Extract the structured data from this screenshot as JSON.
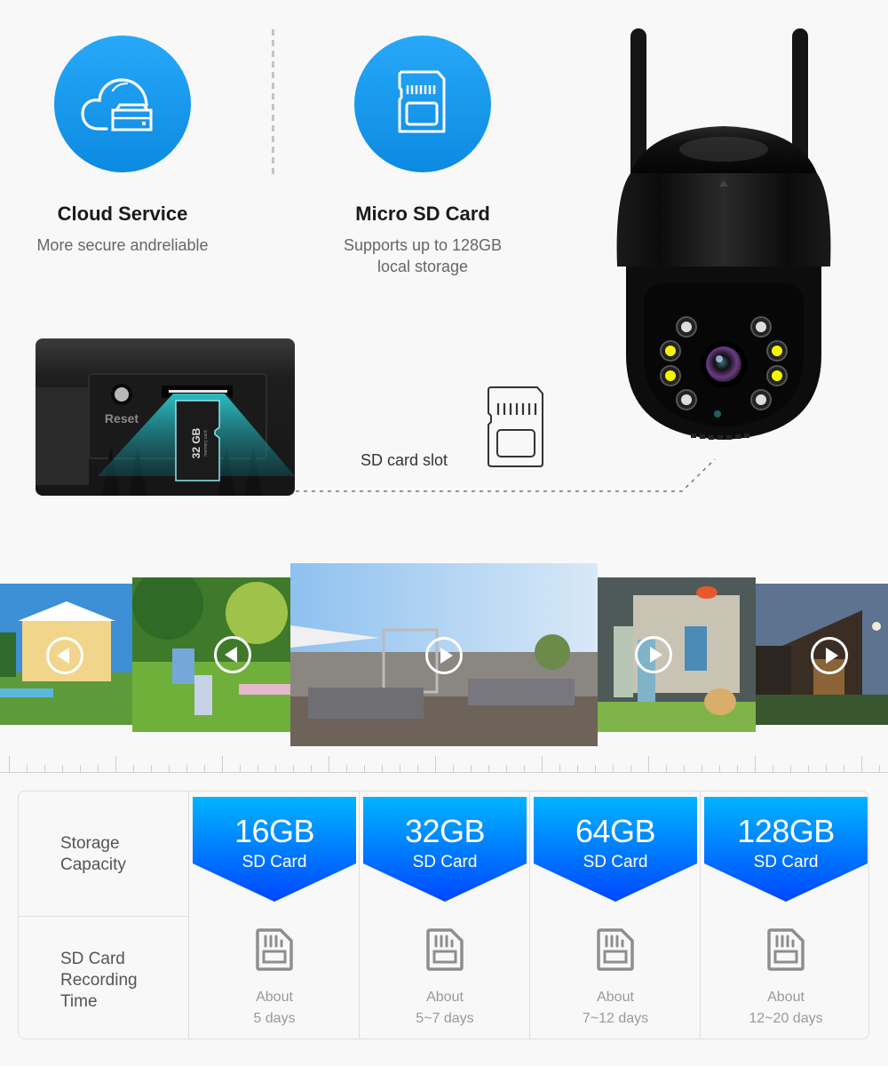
{
  "features": [
    {
      "icon": "cloud-storage-icon",
      "title": "Cloud Service",
      "subtitle": [
        "More secure andreliable"
      ]
    },
    {
      "icon": "micro-sd-card-icon",
      "title": "Micro SD Card",
      "subtitle": [
        "Supports up to 128GB",
        "local storage"
      ]
    }
  ],
  "slot_photo": {
    "reset_label": "Reset",
    "card_label": "32 GB",
    "card_sublabel": "memory card"
  },
  "slot_callout": {
    "label": "SD card slot",
    "icon": "sd-card-outline-icon"
  },
  "camera": {
    "name": "PTZ security camera"
  },
  "photos": [
    {
      "scene": "yellow villa with pool",
      "icon": "play-icon"
    },
    {
      "scene": "family picnic on lawn",
      "icon": "play-icon"
    },
    {
      "scene": "rooftop terrace lounge",
      "icon": "play-icon"
    },
    {
      "scene": "family playing frisbee with dog",
      "icon": "play-icon"
    },
    {
      "scene": "modern house at dusk",
      "icon": "play-icon"
    }
  ],
  "table": {
    "row_headers": [
      [
        "Storage",
        "Capacity"
      ],
      [
        "SD Card",
        "Recording",
        "Time"
      ]
    ],
    "columns": [
      {
        "capacity": "16GB",
        "type": "SD Card",
        "about": "About",
        "days": "5 days"
      },
      {
        "capacity": "32GB",
        "type": "SD Card",
        "about": "About",
        "days": "5~7 days"
      },
      {
        "capacity": "64GB",
        "type": "SD Card",
        "about": "About",
        "days": "7~12 days"
      },
      {
        "capacity": "128GB",
        "type": "SD Card",
        "about": "About",
        "days": "12~20 days"
      }
    ]
  },
  "colors": {
    "accent_blue": "#1897ec",
    "banner_top": "#00b4ff",
    "banner_bottom": "#0046ff",
    "muted_text": "#999999",
    "background": "#f8f8f8"
  }
}
